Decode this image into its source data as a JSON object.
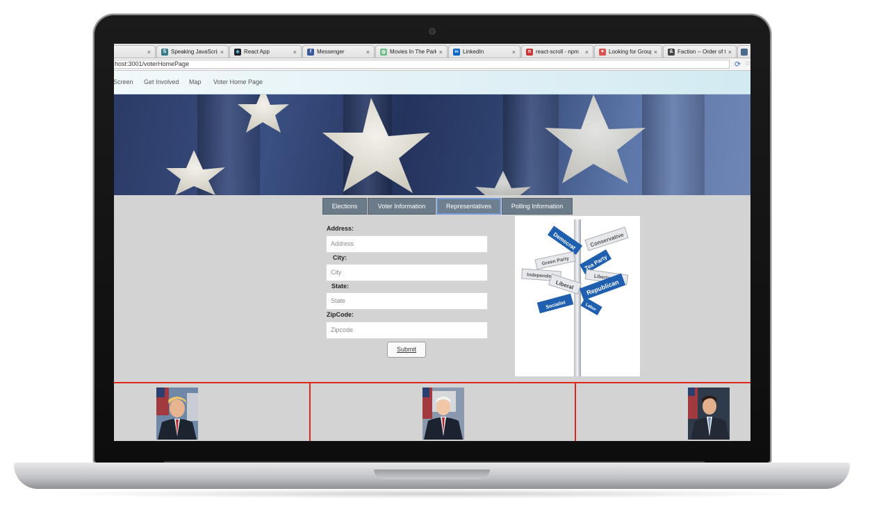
{
  "browser": {
    "tabs": [
      {
        "label": "",
        "fav_color": "#c9c9c9",
        "fav_glyph": ""
      },
      {
        "label": "Speaking JavaScript",
        "fav_color": "#3a7a8a",
        "fav_glyph": "S"
      },
      {
        "label": "React App",
        "fav_color": "#20232a",
        "fav_glyph": "⚛"
      },
      {
        "label": "Messenger",
        "fav_color": "#3b5998",
        "fav_glyph": "f"
      },
      {
        "label": "Movies In The Park -",
        "fav_color": "#6fbf8a",
        "fav_glyph": "✿"
      },
      {
        "label": "LinkedIn",
        "fav_color": "#0a66c2",
        "fav_glyph": "in"
      },
      {
        "label": "react-scroll - npm",
        "fav_color": "#cb3837",
        "fav_glyph": "n"
      },
      {
        "label": "Looking for Group --",
        "fav_color": "#d9534f",
        "fav_glyph": "♥"
      },
      {
        "label": "Faction -- Order of th",
        "fav_color": "#444444",
        "fav_glyph": "&"
      },
      {
        "label": "",
        "fav_color": "#4a6a8a",
        "fav_glyph": ""
      }
    ],
    "tab_close_glyph": "×",
    "url": "host:3001/voterHomePage"
  },
  "nav": {
    "items": [
      "Screen",
      "Get Involved",
      "Map",
      "Voter Home Page"
    ]
  },
  "page_tabs": [
    "Elections",
    "Voter Information",
    "Representatives",
    "Polling Information"
  ],
  "active_tab": "Representatives",
  "form": {
    "address_label": "Address:",
    "address_placeholder": "Address",
    "city_label": "City:",
    "city_placeholder": "City",
    "state_label": "State:",
    "state_placeholder": "State",
    "zipcode_label": "ZipCode:",
    "zipcode_placeholder": "Zipcode",
    "submit_label": "Submit"
  },
  "signpost": {
    "signs": [
      "Democrat",
      "Conservative",
      "Green Party",
      "Tea Party",
      "Independent",
      "Libertarian",
      "Liberal",
      "Republican",
      "Socialist",
      "Labor"
    ]
  },
  "colors": {
    "divider_red": "#e0251b",
    "tab_bg": "#6c7b89",
    "active_tab_border": "#6f9ad6",
    "sign_blue": "#1f5fb0"
  }
}
